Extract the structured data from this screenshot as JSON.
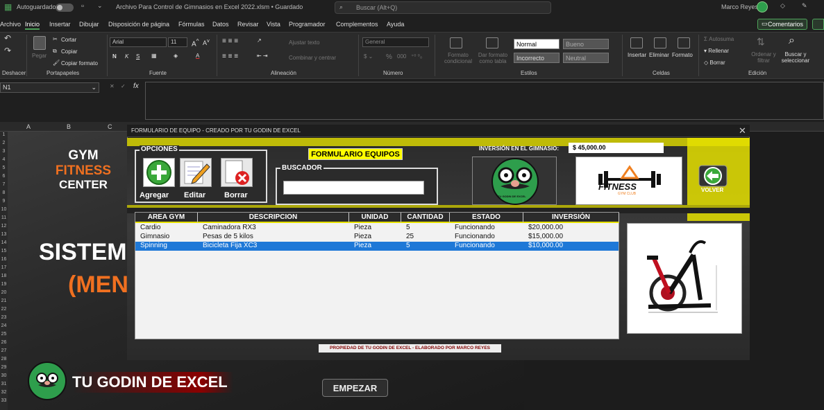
{
  "titlebar": {
    "autosave_label": "Autoguardado",
    "file_title": "Archivo Para Control de Gimnasios en Excel 2022.xlsm • Guardado",
    "search_placeholder": "Buscar (Alt+Q)",
    "user_name": "Marco Reyes"
  },
  "menu": {
    "items": [
      "Archivo",
      "Inicio",
      "Insertar",
      "Dibujar",
      "Disposición de página",
      "Fórmulas",
      "Datos",
      "Revisar",
      "Vista",
      "Programador",
      "Complementos",
      "Ayuda"
    ],
    "comments_button": "Comentarios"
  },
  "ribbon": {
    "undo_group": "Deshacer",
    "clipboard": {
      "paste": "Pegar",
      "cut": "Cortar",
      "copy": "Copiar",
      "format_painter": "Copiar formato",
      "group": "Portapapeles"
    },
    "font": {
      "name": "Arial",
      "size": "11",
      "group": "Fuente",
      "bold": "N",
      "italic": "K",
      "underline": "S"
    },
    "alignment": {
      "wrap": "Ajustar texto",
      "merge": "Combinar y centrar",
      "group": "Alineación"
    },
    "number": {
      "format": "General",
      "percent": "%",
      "thousands": "000",
      "group": "Número"
    },
    "styles": {
      "conditional": "Formato condicional",
      "table": "Dar formato como tabla",
      "normal": "Normal",
      "bueno": "Bueno",
      "incorrecto": "Incorrecto",
      "neutral": "Neutral",
      "group": "Estilos"
    },
    "cells": {
      "insert": "Insertar",
      "delete": "Eliminar",
      "format": "Formato",
      "group": "Celdas"
    },
    "editing": {
      "autosum": "Autosuma",
      "fill": "Rellenar",
      "clear": "Borrar",
      "sort": "Ordenar y filtrar",
      "find": "Buscar y seleccionar",
      "group": "Edición"
    }
  },
  "formula_bar": {
    "name_box": "N1",
    "fx": "fx"
  },
  "columns": [
    "A",
    "B",
    "C"
  ],
  "rows": [
    "1",
    "2",
    "3",
    "4",
    "5",
    "6",
    "7",
    "8",
    "9",
    "10",
    "11",
    "12",
    "13",
    "14",
    "15",
    "16",
    "17",
    "18",
    "19",
    "20",
    "21",
    "22",
    "23",
    "24",
    "25",
    "26",
    "27",
    "28",
    "29",
    "30",
    "31",
    "32",
    "33"
  ],
  "sheet": {
    "gym_line1": "GYM",
    "gym_line2": "FITNESS",
    "gym_line3": "CENTER",
    "big1": "SISTEM",
    "big2": "(MEN",
    "brand": "TU GODIN DE EXCEL",
    "start_button": "EMPEZAR"
  },
  "form": {
    "title": "FORMULARIO DE EQUIPO - CREADO POR TU GODIN DE EXCEL",
    "options_label": "OPCIONES",
    "add_label": "Agregar",
    "edit_label": "Editar",
    "delete_label": "Borrar",
    "search_label": "BUSCADOR",
    "search_value": "",
    "header_title": "FORMULARIO EQUIPOS",
    "investment_label": "INVERSIÓN EN EL GIMNASIO:",
    "investment_value": "$ 45,000.00",
    "logo1_text": "TU GODIN DE EXCEL",
    "logo2_text": "FITNESS",
    "logo2_sub": "GYM CLUB",
    "back_label": "VOLVER",
    "footer": "PROPIEDAD DE TU GODIN DE EXCEL - ELABORADO POR MARCO REYES",
    "columns": [
      "AREA GYM",
      "DESCRIPCION",
      "UNIDAD",
      "CANTIDAD",
      "ESTADO",
      "INVERSIÓN"
    ],
    "rows": [
      [
        "Cardio",
        "Caminadora RX3",
        "Pieza",
        "5",
        "Funcionando",
        "$20,000.00"
      ],
      [
        "Gimnasio",
        "Pesas de 5 kilos",
        "Pieza",
        "25",
        "Funcionando",
        "$15,000.00"
      ],
      [
        "Spinning",
        "Bicicleta Fija XC3",
        "Pieza",
        "5",
        "Funcionando",
        "$10,000.00"
      ]
    ],
    "selected_row": 2
  },
  "colors": {
    "accent_green": "#4ea35a",
    "form_yellow": "#e5e000",
    "selection_blue": "#1e78d7"
  }
}
